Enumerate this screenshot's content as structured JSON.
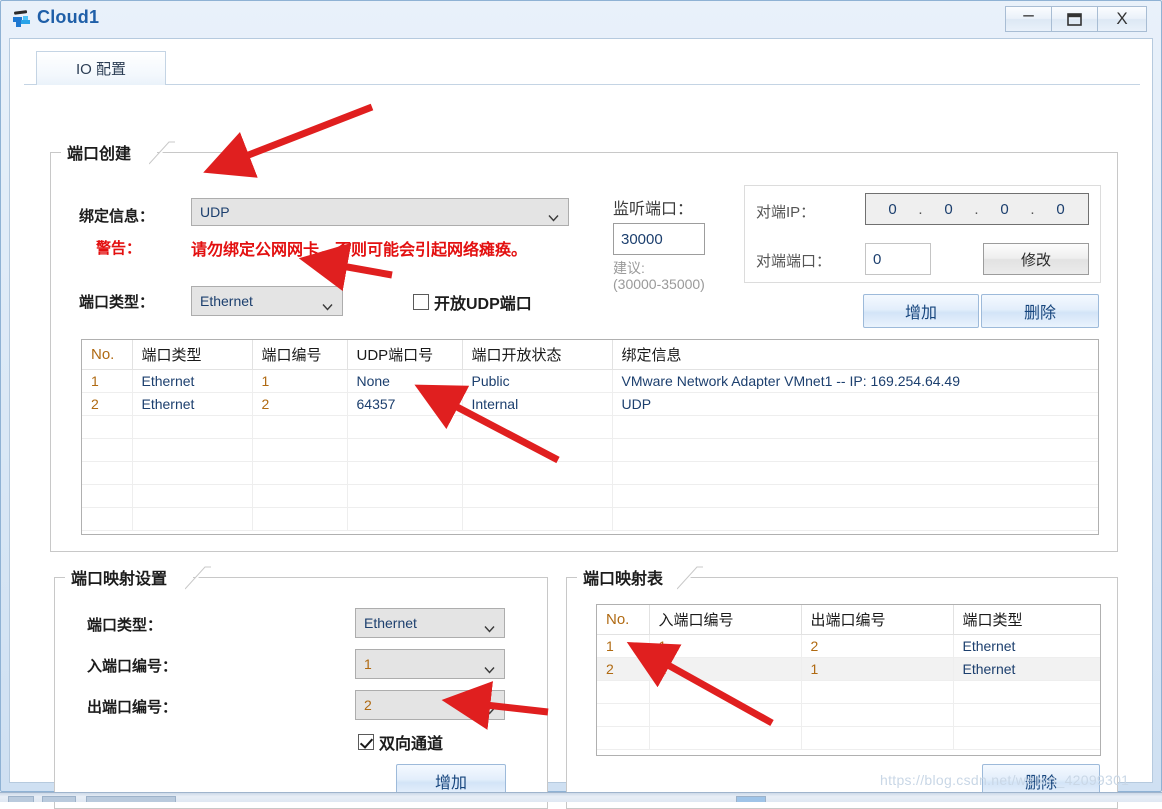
{
  "window": {
    "title": "Cloud1",
    "icon": "cloud-device-icon",
    "buttons": {
      "minimize": "–",
      "maximize": "❑",
      "close": "X"
    }
  },
  "tabs": [
    {
      "label": "IO 配置",
      "active": true
    }
  ],
  "port_create": {
    "title": "端口创建",
    "bind_info_label": "绑定信息：",
    "bind_info_value": "UDP",
    "warning_label": "警告：",
    "warning_text": "请勿绑定公网网卡，否则可能会引起网络瘫痪。",
    "port_type_label": "端口类型：",
    "port_type_value": "Ethernet",
    "open_udp_checkbox_label": "开放UDP端口",
    "open_udp_checked": false,
    "listen_port_label": "监听端口：",
    "listen_port_value": "30000",
    "suggest_label": "建议:",
    "suggest_range": "(30000-35000)",
    "peer_ip_label": "对端IP：",
    "peer_ip_octets": [
      "0",
      "0",
      "0",
      "0"
    ],
    "peer_port_label": "对端端口：",
    "peer_port_value": "0",
    "modify_button": "修改",
    "add_button": "增加",
    "delete_button": "删除"
  },
  "port_table": {
    "columns": [
      "No.",
      "端口类型",
      "端口编号",
      "UDP端口号",
      "端口开放状态",
      "绑定信息"
    ],
    "rows": [
      [
        "1",
        "Ethernet",
        "1",
        "None",
        "Public",
        "VMware Network Adapter VMnet1 -- IP: 169.254.64.49"
      ],
      [
        "2",
        "Ethernet",
        "2",
        "64357",
        "Internal",
        "UDP"
      ]
    ],
    "empty_rows": 5
  },
  "map_settings": {
    "title": "端口映射设置",
    "port_type_label": "端口类型：",
    "port_type_value": "Ethernet",
    "in_port_label": "入端口编号：",
    "in_port_value": "1",
    "out_port_label": "出端口编号：",
    "out_port_value": "2",
    "bidirectional_label": "双向通道",
    "bidirectional_checked": true,
    "add_button": "增加"
  },
  "map_table": {
    "title": "端口映射表",
    "columns": [
      "No.",
      "入端口编号",
      "出端口编号",
      "端口类型"
    ],
    "rows": [
      [
        "1",
        "1",
        "2",
        "Ethernet"
      ],
      [
        "2",
        "2",
        "1",
        "Ethernet"
      ]
    ],
    "selected_row_index": 1,
    "empty_rows": 3,
    "delete_button": "删除"
  },
  "watermark": "https://blog.csdn.net/weixin_42099301",
  "colors": {
    "title_blue": "#1f5fa8",
    "warning_red": "#e31010",
    "annotation_red": "#e01f1f",
    "table_value_blue": "#1c3f6e",
    "number_orange": "#b06a12"
  },
  "annotations": {
    "arrow_color": "#e01f1f",
    "count": 4,
    "targets": [
      "bind-info-combo",
      "port-type-combo",
      "port-table-rows",
      "map-table-row-2",
      "bidirectional-checkbox"
    ]
  }
}
